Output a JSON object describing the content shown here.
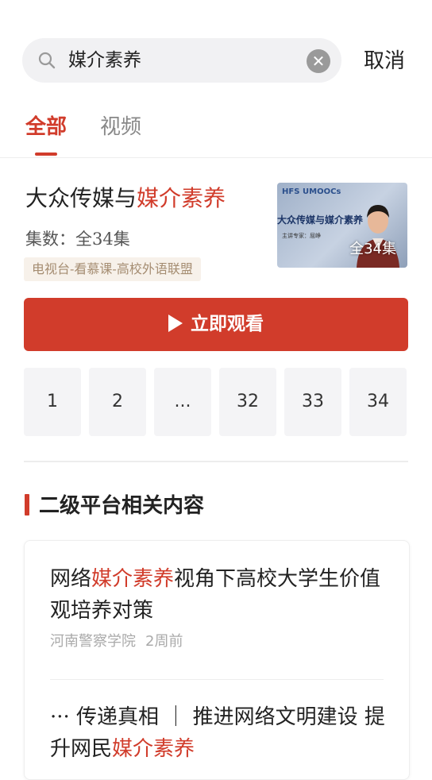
{
  "search": {
    "query": "媒介素养",
    "cancel_label": "取消"
  },
  "tabs": [
    {
      "label": "全部",
      "active": true
    },
    {
      "label": "视频",
      "active": false
    }
  ],
  "course": {
    "title_prefix": "大众传媒与",
    "title_highlight": "媒介素养",
    "episode_count": "集数：全34集",
    "source_tag": "电视台-看慕课-高校外语联盟",
    "thumbnail": {
      "logo_left": "HFS",
      "logo_right": "UMOOCs",
      "title": "大众传媒与媒介素养",
      "subtitle": "主讲专家：屈峥",
      "count_overlay": "全34集"
    },
    "watch_label": "立即观看",
    "episodes": [
      "1",
      "2",
      "...",
      "32",
      "33",
      "34"
    ]
  },
  "section": {
    "title": "二级平台相关内容"
  },
  "articles": [
    {
      "title_prefix": "网络",
      "title_highlight": "媒介素养",
      "title_suffix": "视角下高校大学生价值观培养对策",
      "source": "河南警察学院",
      "time": "2周前"
    },
    {
      "title_prefix": "··· 传递真相 ｜ 推进网络文明建设 提升网民",
      "title_highlight": "媒介素养",
      "title_suffix": ""
    }
  ],
  "colors": {
    "accent": "#d13c2b",
    "tag_bg": "#f7f1ea",
    "tag_text": "#a58d72"
  }
}
